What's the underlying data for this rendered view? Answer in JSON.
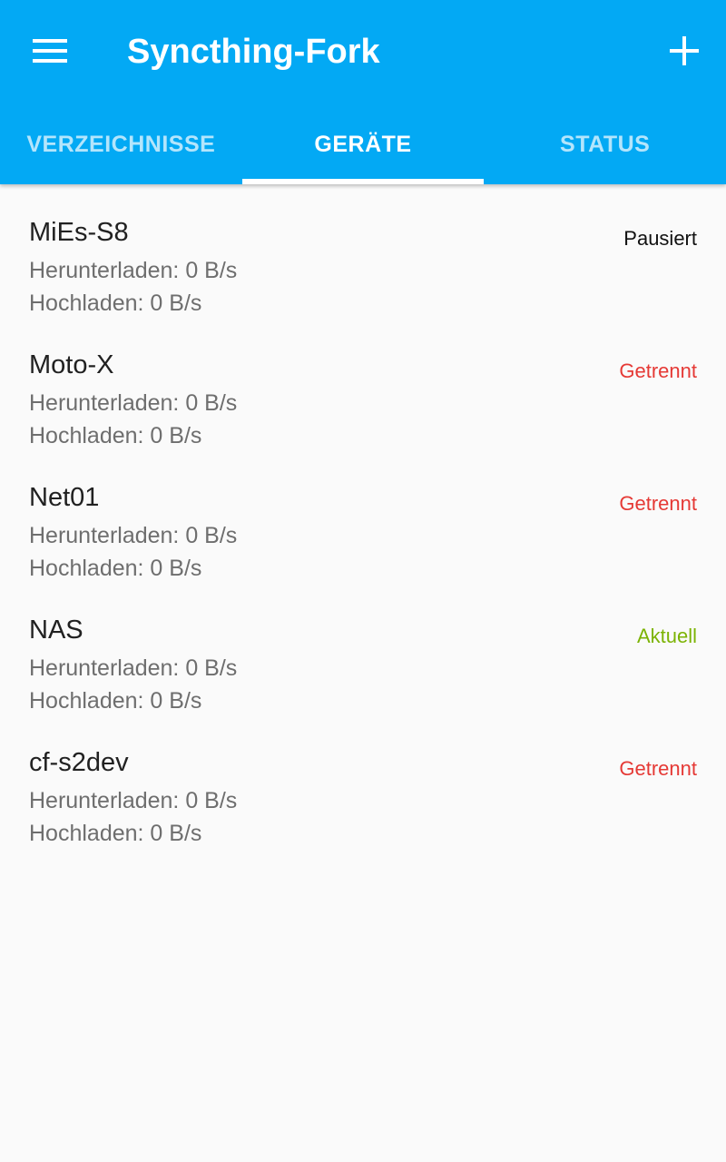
{
  "header": {
    "title": "Syncthing-Fork",
    "menu_icon": "hamburger-menu-icon",
    "add_icon": "plus-icon"
  },
  "tabs": [
    {
      "label": "VERZEICHNISSE",
      "active": false
    },
    {
      "label": "GERÄTE",
      "active": true
    },
    {
      "label": "STATUS",
      "active": false
    }
  ],
  "colors": {
    "primary": "#03a9f4",
    "status_paused": "#111111",
    "status_disconnected": "#e53935",
    "status_uptodate": "#7cb305"
  },
  "devices": [
    {
      "name": "MiEs-S8",
      "download": "Herunterladen: 0 B/s",
      "upload": "Hochladen: 0 B/s",
      "status": "Pausiert",
      "status_color": "#111111"
    },
    {
      "name": "Moto-X",
      "download": "Herunterladen: 0 B/s",
      "upload": "Hochladen: 0 B/s",
      "status": "Getrennt",
      "status_color": "#e53935"
    },
    {
      "name": "Net01",
      "download": "Herunterladen: 0 B/s",
      "upload": "Hochladen: 0 B/s",
      "status": "Getrennt",
      "status_color": "#e53935"
    },
    {
      "name": "NAS",
      "download": "Herunterladen: 0 B/s",
      "upload": "Hochladen: 0 B/s",
      "status": "Aktuell",
      "status_color": "#7cb305"
    },
    {
      "name": "cf-s2dev",
      "download": "Herunterladen: 0 B/s",
      "upload": "Hochladen: 0 B/s",
      "status": "Getrennt",
      "status_color": "#e53935"
    }
  ]
}
